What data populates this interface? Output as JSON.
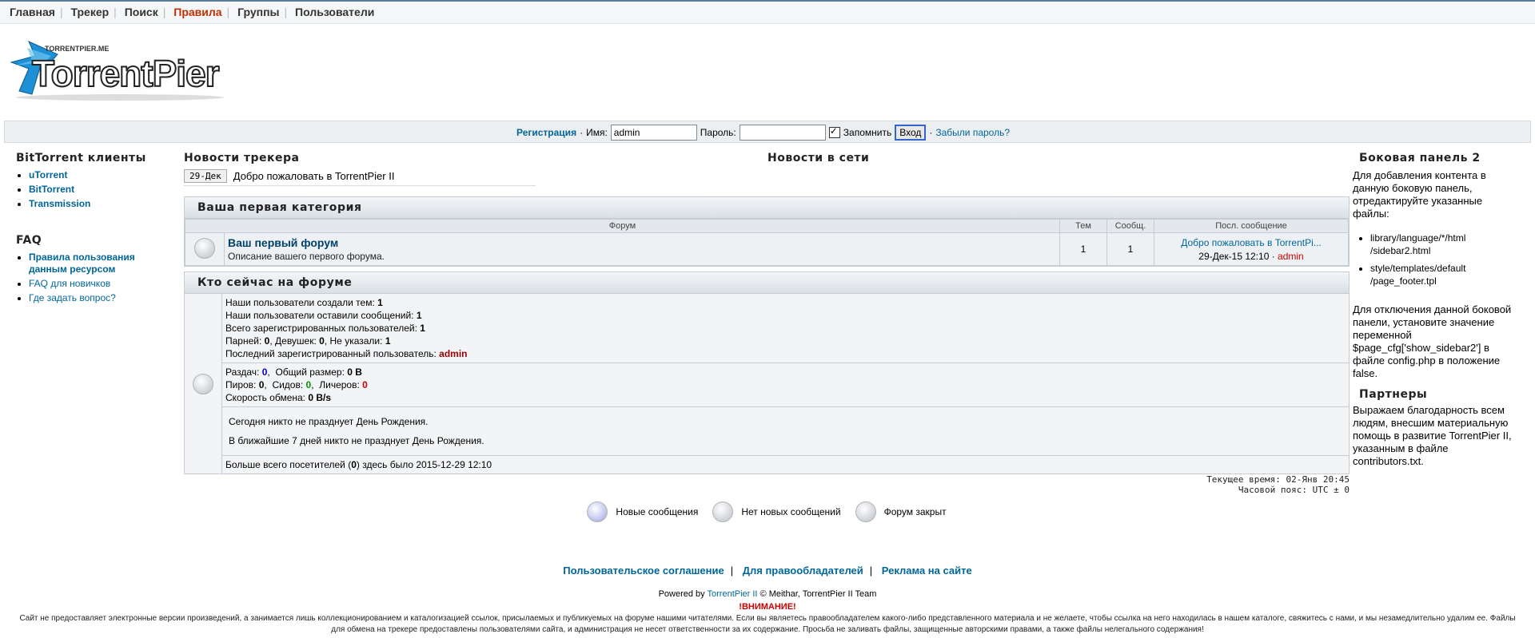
{
  "topnav": [
    "Главная",
    "Трекер",
    "Поиск",
    "Правила",
    "Группы",
    "Пользователи"
  ],
  "topnav_active": "Правила",
  "logo": {
    "small_text": "TORRENTPIER.ME",
    "big_text": "TorrentPier"
  },
  "login": {
    "register": "Регистрация",
    "name_label": "Имя:",
    "name_value": "admin",
    "password_label": "Пароль:",
    "remember_label": "Запомнить",
    "login_button": "Вход",
    "forgot": "Забыли пароль?"
  },
  "left": {
    "clients_title": "BitTorrent клиенты",
    "clients": [
      "uTorrent",
      "BitTorrent",
      "Transmission"
    ],
    "faq_title": "FAQ",
    "faq": [
      "Правила пользования данным ресурсом",
      "FAQ для новичков",
      "Где задать вопрос?"
    ]
  },
  "news": {
    "tracker_title": "Новости трекера",
    "net_title": "Новости в сети",
    "date": "29-Дек",
    "text": "Добро пожаловать в TorrentPier II"
  },
  "category": {
    "title": "Ваша первая категория",
    "col_forum": "Форум",
    "col_topics": "Тем",
    "col_posts": "Сообщ.",
    "col_last": "Посл. сообщение",
    "forum_name": "Ваш первый форум",
    "forum_desc": "Описание вашего первого форума.",
    "topics": "1",
    "posts": "1",
    "last_title": "Добро пожаловать в TorrentPi...",
    "last_date": "29-Дек-15 12:10",
    "last_user": "admin"
  },
  "who": {
    "title": "Кто сейчас на форуме",
    "topics_label": "Наши пользователи создали тем:",
    "topics": "1",
    "posts_label": "Наши пользователи оставили сообщений:",
    "posts": "1",
    "users_label": "Всего зарегистрированных пользователей:",
    "users": "1",
    "male_label": "Парней:",
    "male": "0",
    "female_label": "Девушек:",
    "female": "0",
    "unknown_label": "Не указали:",
    "unknown": "1",
    "last_user_label": "Последний зарегистрированный пользователь:",
    "last_user": "admin",
    "releases_label": "Раздач:",
    "releases": "0",
    "size_label": "Общий размер:",
    "size": "0 B",
    "peers_label": "Пиров:",
    "peers": "0",
    "seeds_label": "Сидов:",
    "seeds": "0",
    "leech_label": "Личеров:",
    "leech": "0",
    "speed_label": "Скорость обмена:",
    "speed": "0 B/s",
    "bday_today": "Сегодня никто не празднует День Рождения.",
    "bday_week": "В ближайшие 7 дней никто не празднует День Рождения.",
    "max_visitors_pre": "Больше всего посетителей (",
    "max_visitors": "0",
    "max_visitors_post": ") здесь было 2015-12-29 12:10"
  },
  "time": {
    "current": "Текущее время: 02-Янв 20:45",
    "zone": "Часовой пояс: UTC ± 0"
  },
  "legend": {
    "new": "Новые сообщения",
    "nonew": "Нет новых сообщений",
    "locked": "Форум закрыт"
  },
  "right": {
    "sidebar_title": "Боковая панель 2",
    "sidebar_text": "Для добавления контента в данную боковую панель, отредактируйте указанные файлы:",
    "files": [
      "library/language/*/html /sidebar2.html",
      "style/templates/default /page_footer.tpl"
    ],
    "disable_text": "Для отключения данной боковой панели, установите значение переменной $page_cfg['show_sidebar2'] в файле config.php в положение false.",
    "partners_title": "Партнеры",
    "partners_text": "Выражаем благодарность всем людям, внесшим материальную помощь в развитие TorrentPier II, указанным в файле contributors.txt."
  },
  "footer": {
    "links": [
      "Пользовательское соглашение",
      "Для правообладателей",
      "Реклама на сайте"
    ],
    "powered_pre": "Powered by ",
    "powered_link": "TorrentPier II",
    "powered_post": " © Meithar, TorrentPier II Team",
    "warning": "!ВНИМАНИЕ!",
    "disclaimer1": "Сайт не предоставляет электронные версии произведений, а занимается лишь коллекционированием и каталогизацией ссылок, присылаемых и публикуемых на форуме нашими читателями. Если вы являетесь правообладателем какого-либо представленного материала и не желаете, чтобы ссылка на него находилась в нашем каталоге, свяжитесь с нами, и мы незамедлительно удалим ее. Файлы",
    "disclaimer2": "для обмена на трекере предоставлены пользователями сайта, и администрация не несет ответственности за их содержание. Просьба не заливать файлы, защищенные авторскими правами, а также файлы нелегального содержания!"
  }
}
